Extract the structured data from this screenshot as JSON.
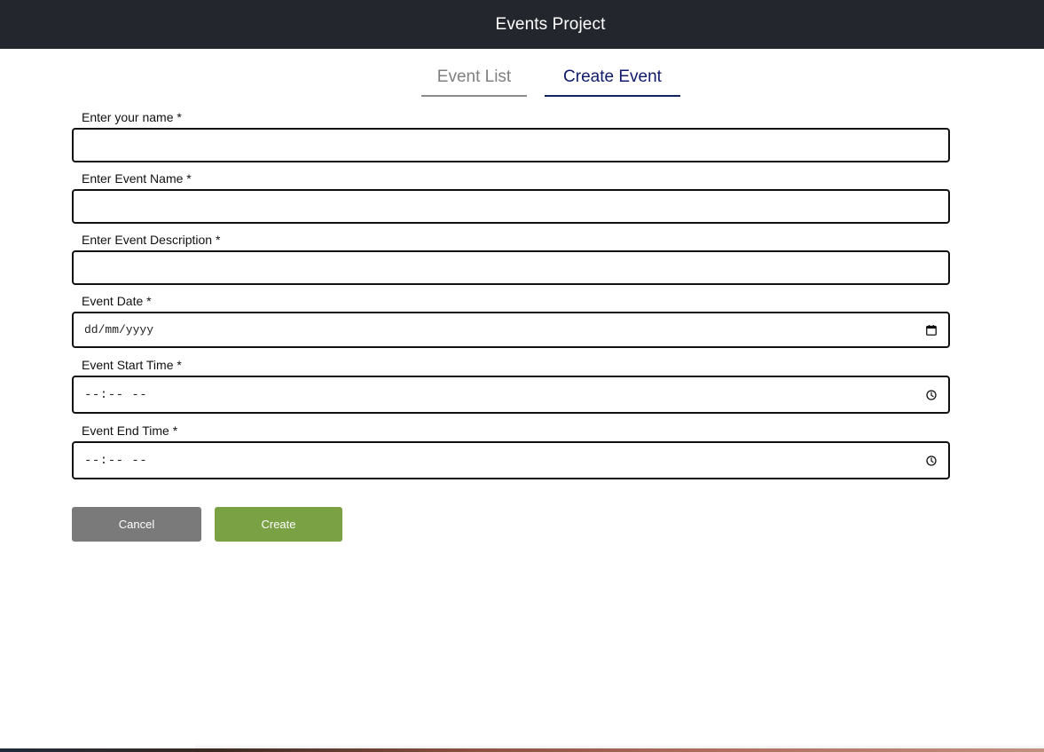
{
  "header": {
    "title": "Events Project"
  },
  "tabs": [
    {
      "label": "Event List",
      "active": false
    },
    {
      "label": "Create Event",
      "active": true
    }
  ],
  "form": {
    "fields": [
      {
        "label": "Enter your name *",
        "value": ""
      },
      {
        "label": "Enter Event Name *",
        "value": ""
      },
      {
        "label": "Enter Event Description *",
        "value": ""
      },
      {
        "label": "Event Date *",
        "placeholder": "dd/mm/yyyy",
        "icon": "calendar-icon"
      },
      {
        "label": "Event Start Time *",
        "placeholder": "--:-- --",
        "icon": "clock-icon"
      },
      {
        "label": "Event End Time *",
        "placeholder": "--:-- --",
        "icon": "clock-icon"
      }
    ]
  },
  "buttons": {
    "cancel": "Cancel",
    "create": "Create"
  },
  "colors": {
    "header_bg": "#23262d",
    "active_tab": "#0f1a6b",
    "cancel_bg": "#7a7a7a",
    "create_bg": "#7aa143"
  }
}
